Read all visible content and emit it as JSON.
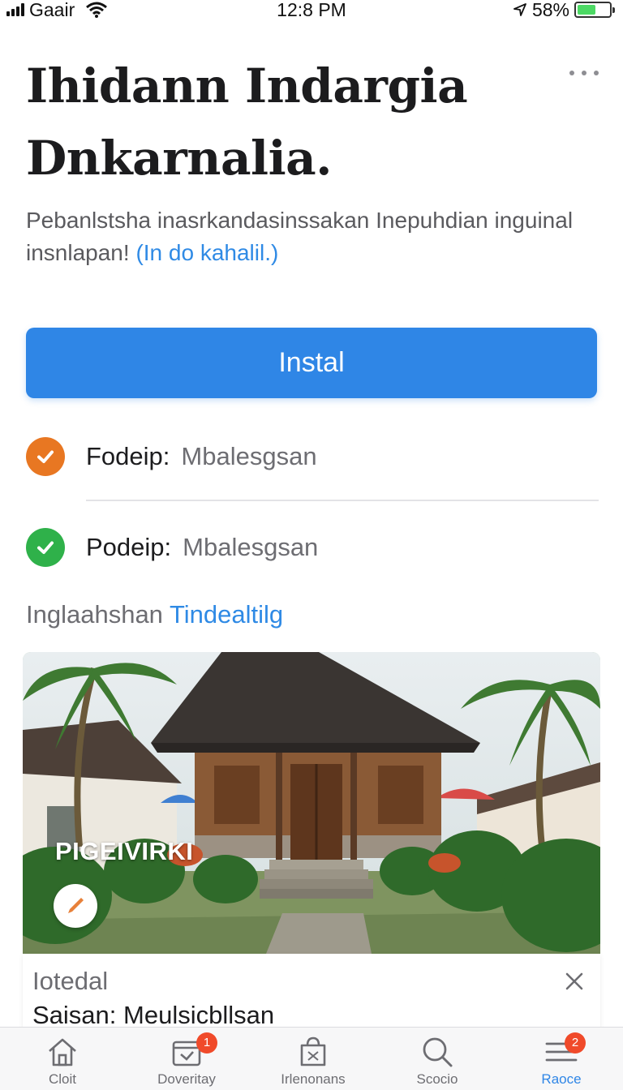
{
  "status_bar": {
    "carrier": "Gaair",
    "time": "12:8 PM",
    "battery": "58%",
    "battery_level": 0.58
  },
  "header": {
    "title": "Ihidann Indargia Dnkarnalia.",
    "subtitle": "Pebanlstsha inasrkandasinssakan Inepuhdian inguinal insnlapan!",
    "subtitle_link": "(In do kahalil.)"
  },
  "install_button": {
    "label": "Instal"
  },
  "features": [
    {
      "key": "Fodeip:",
      "value": "Mbalesgsan",
      "icon": "check-circle-icon",
      "color": "#e87722"
    },
    {
      "key": "Podeip:",
      "value": "Mbalesgsan",
      "icon": "check-circle-icon",
      "color": "#2fb14a"
    }
  ],
  "section": {
    "prefix": "Inglaahshan",
    "link": "Tindealtilg"
  },
  "image_card": {
    "overlay_label": "PIGEIVIRKI",
    "edit_icon": "pencil-icon"
  },
  "info_panel": {
    "label": "Iotedal",
    "value": "Saisan: Meulsicbllsan",
    "close_icon": "close-icon"
  },
  "tab_bar": {
    "tabs": [
      {
        "label": "Cloit",
        "icon": "home-icon"
      },
      {
        "label": "Doveritay",
        "icon": "calendar-icon",
        "badge": "1"
      },
      {
        "label": "Irlenonans",
        "icon": "bag-icon"
      },
      {
        "label": "Scocio",
        "icon": "search-icon"
      },
      {
        "label": "Raoce",
        "icon": "menu-icon",
        "badge": "2",
        "active": true
      }
    ]
  },
  "colors": {
    "accent": "#2f86e6",
    "link": "#2f8ae5",
    "badge": "#f04a2a"
  }
}
